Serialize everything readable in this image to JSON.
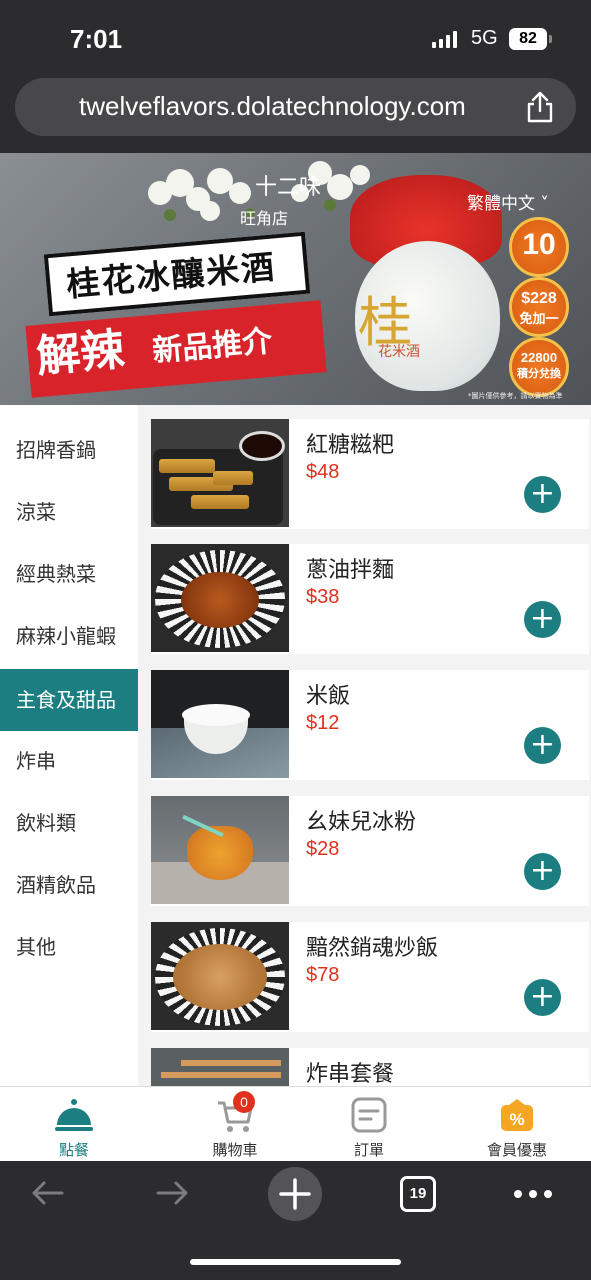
{
  "status_bar": {
    "time": "7:01",
    "network": "5G",
    "battery": "82"
  },
  "browser": {
    "url": "twelveflavors.dolatechnology.com",
    "tab_count": "19"
  },
  "banner": {
    "store_name": "十二味",
    "store_branch": "旺角店",
    "language": "繁體中文 ˅",
    "title": "桂花冰釀米酒",
    "highlight": "解辣",
    "subtitle": "新品推介",
    "jar_text": "桂",
    "jar_brand": "花米酒",
    "badges": [
      {
        "top": "10",
        "bottom": ""
      },
      {
        "top": "$228",
        "bottom": "免加一"
      },
      {
        "top": "22800",
        "bottom": "積分兌換"
      }
    ],
    "note": "*圖片僅供參考，請以實物為準"
  },
  "categories": [
    {
      "label": "招牌香鍋",
      "active": false
    },
    {
      "label": "涼菜",
      "active": false
    },
    {
      "label": "經典熱菜",
      "active": false
    },
    {
      "label": "麻辣小龍蝦",
      "active": false
    },
    {
      "label": "主食及甜品",
      "active": true
    },
    {
      "label": "炸串",
      "active": false
    },
    {
      "label": "飲料類",
      "active": false
    },
    {
      "label": "酒精飲品",
      "active": false
    },
    {
      "label": "其他",
      "active": false
    }
  ],
  "menu_items": [
    {
      "name": "紅糖糍粑",
      "price": "$48"
    },
    {
      "name": "蔥油拌麵",
      "price": "$38"
    },
    {
      "name": "米飯",
      "price": "$12"
    },
    {
      "name": "幺妹兒冰粉",
      "price": "$28"
    },
    {
      "name": "黯然銷魂炒飯",
      "price": "$78"
    },
    {
      "name": "炸串套餐",
      "price": ""
    }
  ],
  "add_button_symbol": "+",
  "tab_bar": {
    "tabs": [
      {
        "label": "點餐",
        "icon": "cloche-icon",
        "active": true
      },
      {
        "label": "購物車",
        "icon": "cart-icon",
        "active": false
      },
      {
        "label": "訂單",
        "icon": "order-icon",
        "active": false
      },
      {
        "label": "會員優惠",
        "icon": "discount-icon",
        "active": false
      }
    ],
    "cart_count": "0"
  },
  "colors": {
    "accent": "#1c7e80",
    "price": "#e0301e",
    "badge": "#e0301e"
  }
}
